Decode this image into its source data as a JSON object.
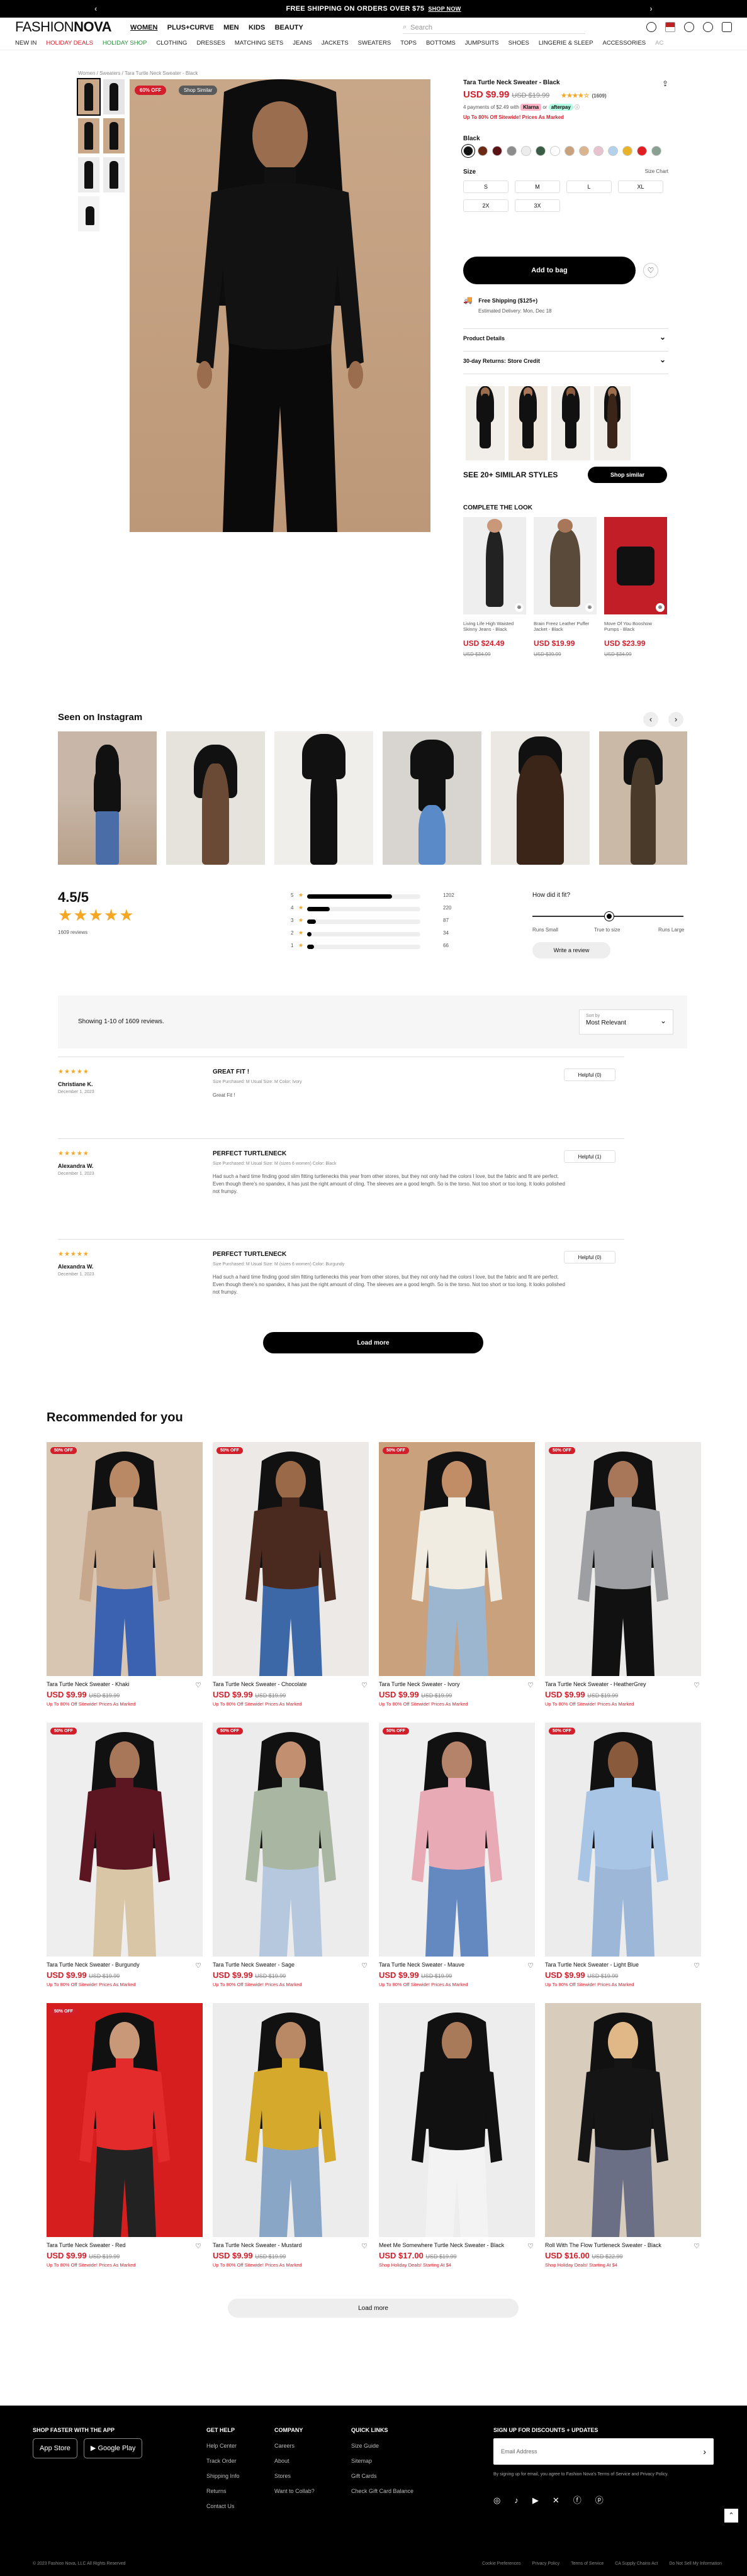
{
  "promo": {
    "text": "FREE SHIPPING ON ORDERS OVER $75",
    "link": "SHOP NOW"
  },
  "header": {
    "logo_a": "FASHION",
    "logo_b": "NOVA",
    "top_nav": [
      "WOMEN",
      "PLUS+CURVE",
      "MEN",
      "KIDS",
      "BEAUTY"
    ],
    "search_placeholder": "Search",
    "sub_nav": [
      "NEW IN",
      "HOLIDAY DEALS",
      "HOLIDAY SHOP",
      "CLOTHING",
      "DRESSES",
      "MATCHING SETS",
      "JEANS",
      "JACKETS",
      "SWEATERS",
      "TOPS",
      "BOTTOMS",
      "JUMPSUITS",
      "SHOES",
      "LINGERIE & SLEEP",
      "ACCESSORIES",
      "AC"
    ]
  },
  "breadcrumb": "Women  /  Sweaters  /  Tara Turtle Neck Sweater - Black",
  "hero": {
    "badge": "60% OFF",
    "badge2": "Shop Similar"
  },
  "product": {
    "title": "Tara Turtle Neck Sweater - Black",
    "price": "USD $9.99",
    "old_price": "USD $19.99",
    "reviews_count": "(1609)",
    "installments": "4 payments of $2.49 with",
    "klarna": "Klarna",
    "or": "or",
    "afterpay": "afterpay",
    "promo": "Up To 80% Off Sitewide! Prices As Marked",
    "color_label": "Black",
    "colors": [
      "#111111",
      "#6b2a14",
      "#5b1217",
      "#8c8c8c",
      "#ececec",
      "#3a5b45",
      "#ffffff",
      "#c9a27c",
      "#d9b48f",
      "#e8c2cf",
      "#b3d1ea",
      "#e8b32a",
      "#e01e22",
      "#8aa192"
    ],
    "size_label": "Size",
    "size_chart": "Size Chart",
    "sizes": [
      "S",
      "M",
      "L",
      "XL",
      "2X",
      "3X"
    ],
    "add_to_bag": "Add to bag",
    "shipping_title": "Free Shipping ($125+)",
    "shipping_delivery": "Estimated Delivery: Mon, Dec 18",
    "details": "Product Details",
    "returns": "30-day Returns: Store Credit",
    "similar_text": "SEE 20+ SIMILAR STYLES",
    "shop_similar": "Shop similar"
  },
  "complete_look": {
    "title": "COMPLETE THE LOOK",
    "items": [
      {
        "name": "Living Life High Waisted Skinny Jeans - Black",
        "price": "USD $24.49",
        "old": "USD $34.99"
      },
      {
        "name": "Brain Freez Leather Puffer Jacket - Black",
        "price": "USD $19.99",
        "old": "USD $39.99"
      },
      {
        "name": "Move Of You Booshow Pumps - Black",
        "price": "USD $23.99",
        "old": "USD $34.99"
      }
    ]
  },
  "instagram": {
    "title": "Seen on Instagram"
  },
  "ratings": {
    "score": "4.5/5",
    "count": "1609 reviews",
    "bars": [
      {
        "label": "5",
        "count": "1202",
        "fill": 0.75
      },
      {
        "label": "4",
        "count": "220",
        "fill": 0.2
      },
      {
        "label": "3",
        "count": "87",
        "fill": 0.08
      },
      {
        "label": "2",
        "count": "34",
        "fill": 0.04
      },
      {
        "label": "1",
        "count": "66",
        "fill": 0.06
      }
    ],
    "fit_title": "How did it fit?",
    "fit_small": "Runs Small",
    "fit_true": "True to size",
    "fit_large": "Runs Large",
    "write": "Write a review"
  },
  "reviews_bar": {
    "showing": "Showing 1-10 of 1609 reviews.",
    "sort_label": "Sort by",
    "sort_value": "Most Relevant"
  },
  "reviews": [
    {
      "author": "Christiane K.",
      "date": "December 1, 2023",
      "title": "GREAT FIT !",
      "meta": "Size Purchased: M    Usual Size: M    Color: Ivory",
      "body": "Great Fit !",
      "helpful": "Helpful (0)"
    },
    {
      "author": "Alexandra W.",
      "date": "December 1, 2023",
      "title": "PERFECT TURTLENECK",
      "meta": "Size Purchased: M    Usual Size: M (sizes 6 women)    Color: Black",
      "body": "Had such a hard time finding good slim fitting turtlenecks this year from other stores, but they not only had the colors I love, but the fabric and fit are perfect. Even though there's no spandex, it has just the right amount of cling. The sleeves are a good length. So is the torso. Not too short or too long. It looks polished not frumpy.",
      "helpful": "Helpful (1)"
    },
    {
      "author": "Alexandra W.",
      "date": "December 1, 2023",
      "title": "PERFECT TURTLENECK",
      "meta": "Size Purchased: M    Usual Size: M (sizes 6 women)    Color: Burgundy",
      "body": "Had such a hard time finding good slim fitting turtlenecks this year from other stores, but they not only had the colors I love, but the fabric and fit are perfect. Even though there's no spandex, it has just the right amount of cling. The sleeves are a good length. So is the torso. Not too short or too long. It looks polished not frumpy.",
      "helpful": "Helpful (0)"
    }
  ],
  "load_more": "Load more",
  "recommended": {
    "title": "Recommended for you",
    "promo": "Up To 80% Off Sitewide! Prices As Marked",
    "items": [
      {
        "name": "Tara Turtle Neck Sweater - Khaki",
        "price": "USD $9.99",
        "old": "USD $19.99",
        "off": "50% OFF",
        "top": "#c8a88c",
        "bottom": "#3a62b0",
        "bg": "#d9c6b2",
        "skin": "#b98865",
        "promo": "Up To 80% Off Sitewide! Prices As Marked"
      },
      {
        "name": "Tara Turtle Neck Sweater - Chocolate",
        "price": "USD $9.99",
        "old": "USD $19.99",
        "off": "50% OFF",
        "top": "#4a2a1e",
        "bottom": "#3d68a8",
        "bg": "#ece9e6",
        "skin": "#9a6a48",
        "promo": "Up To 80% Off Sitewide! Prices As Marked"
      },
      {
        "name": "Tara Turtle Neck Sweater - Ivory",
        "price": "USD $9.99",
        "old": "USD $19.99",
        "off": "50% OFF",
        "top": "#f1ece2",
        "bottom": "#9cb6cf",
        "bg": "#c9a17d",
        "skin": "#c08d66",
        "promo": "Up To 80% Off Sitewide! Prices As Marked"
      },
      {
        "name": "Tara Turtle Neck Sweater - HeatherGrey",
        "price": "USD $9.99",
        "old": "USD $19.99",
        "off": "50% OFF",
        "top": "#9d9fa3",
        "bottom": "#111111",
        "bg": "#ecebea",
        "skin": "#a8775a",
        "promo": "Up To 80% Off Sitewide! Prices As Marked"
      },
      {
        "name": "Tara Turtle Neck Sweater - Burgundy",
        "price": "USD $9.99",
        "old": "USD $19.99",
        "off": "50% OFF",
        "top": "#5c1622",
        "bottom": "#d8c6a6",
        "bg": "#eeeeee",
        "skin": "#a8775a",
        "promo": "Up To 80% Off Sitewide! Prices As Marked"
      },
      {
        "name": "Tara Turtle Neck Sweater - Sage",
        "price": "USD $9.99",
        "old": "USD $19.99",
        "off": "50% OFF",
        "top": "#a8b6a2",
        "bottom": "#b5c8de",
        "bg": "#ececec",
        "skin": "#c29070",
        "promo": "Up To 80% Off Sitewide! Prices As Marked"
      },
      {
        "name": "Tara Turtle Neck Sweater - Mauve",
        "price": "USD $9.99",
        "old": "USD $19.99",
        "off": "50% OFF",
        "top": "#e8aab4",
        "bottom": "#6389c0",
        "bg": "#efefef",
        "skin": "#b5826a",
        "promo": "Up To 80% Off Sitewide! Prices As Marked"
      },
      {
        "name": "Tara Turtle Neck Sweater - Light Blue",
        "price": "USD $9.99",
        "old": "USD $19.99",
        "off": "50% OFF",
        "top": "#a9c5e6",
        "bottom": "#9cb7d8",
        "bg": "#ececec",
        "skin": "#8a5a3c",
        "promo": "Up To 80% Off Sitewide! Prices As Marked"
      },
      {
        "name": "Tara Turtle Neck Sweater - Red",
        "price": "USD $9.99",
        "old": "USD $19.99",
        "off": "50% OFF",
        "top": "#e32b2b",
        "bottom": "#222222",
        "bg": "#d61e1e",
        "skin": "#c89878",
        "promo": "Up To 80% Off Sitewide! Prices As Marked"
      },
      {
        "name": "Tara Turtle Neck Sweater - Mustard",
        "price": "USD $9.99",
        "old": "USD $19.99",
        "off": "",
        "top": "#d4a92c",
        "bottom": "#8aa6c7",
        "bg": "#ececec",
        "skin": "#b98865",
        "promo": "Up To 80% Off Sitewide! Prices As Marked"
      },
      {
        "name": "Meet Me Somewhere Turtle Neck Sweater - Black",
        "price": "USD $17.00",
        "old": "USD $19.99",
        "off": "",
        "top": "#111111",
        "bottom": "#f3f3f3",
        "bg": "#ededed",
        "skin": "#a87a5a",
        "promo": "Shop Holiday Deals! Starting At $4"
      },
      {
        "name": "Roll With The Flow Turtleneck Sweater - Black",
        "price": "USD $16.00",
        "old": "USD $22.99",
        "off": "",
        "top": "#151515",
        "bottom": "#6a6f86",
        "bg": "#d8cdbd",
        "skin": "#e0b888",
        "promo": "Shop Holiday Deals! Starting At $4"
      }
    ]
  },
  "load_more2": "Load more",
  "footer": {
    "app_title": "SHOP FASTER WITH THE APP",
    "appstore": "App Store",
    "googleplay": "Google Play",
    "help_title": "GET HELP",
    "help": [
      "Help Center",
      "Track Order",
      "Shipping Info",
      "Returns",
      "Contact Us"
    ],
    "company_title": "COMPANY",
    "company": [
      "Careers",
      "About",
      "Stores",
      "Want to Collab?"
    ],
    "quick_title": "QUICK LINKS",
    "quick": [
      "Size Guide",
      "Sitemap",
      "Gift Cards",
      "Check Gift Card Balance"
    ],
    "signup_title": "SIGN UP FOR DISCOUNTS + UPDATES",
    "email_placeholder": "Email Address",
    "legal": "By signing up for email, you agree to Fashion Nova's Terms of Service and Privacy Policy.",
    "copyright": "© 2023 Fashion Nova, LLC All Rights Reserved",
    "bottom_links": [
      "Cookie Preferences",
      "Privacy Policy",
      "Terms of Service",
      "CA Supply Chains Act",
      "Do Not Sell My Information"
    ]
  }
}
